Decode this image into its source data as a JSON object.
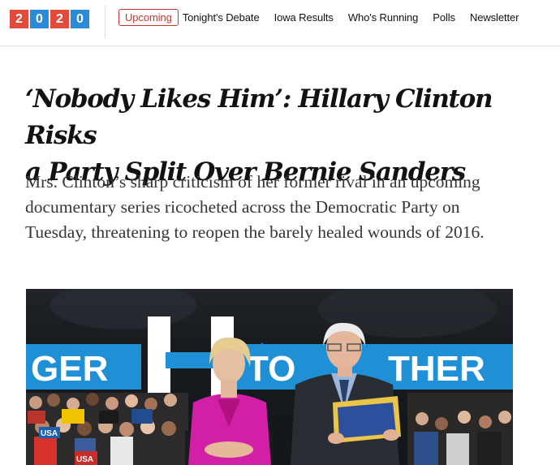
{
  "header": {
    "logo": {
      "digits": [
        "2",
        "0",
        "2",
        "0"
      ],
      "tile_colors": [
        "#e14b3b",
        "#2a8bd9",
        "#e14b3b",
        "#2a8bd9"
      ]
    },
    "nav": [
      {
        "label": "Upcoming",
        "active": true
      },
      {
        "label": "Tonight's Debate",
        "active": false
      },
      {
        "label": "Iowa Results",
        "active": false
      },
      {
        "label": "Who's Running",
        "active": false
      },
      {
        "label": "Polls",
        "active": false
      },
      {
        "label": "Newsletter",
        "active": false
      }
    ],
    "accent_color": "#c3372b"
  },
  "article": {
    "headline_line1": "‘Nobody Likes Him’: Hillary Clinton Risks",
    "headline_line2": "a Party Split Over Bernie Sanders",
    "summary": "Mrs. Clinton’s sharp criticism of her former rival in an upcoming documentary series ricocheted across the Democratic Party on Tuesday, threatening to reopen the barely healed wounds of 2016."
  },
  "photo": {
    "banner_left": "GER",
    "banner_right_a": "TO",
    "banner_right_b": "THER",
    "sign_text": "USA",
    "banner_color": "#1f8fd6"
  }
}
